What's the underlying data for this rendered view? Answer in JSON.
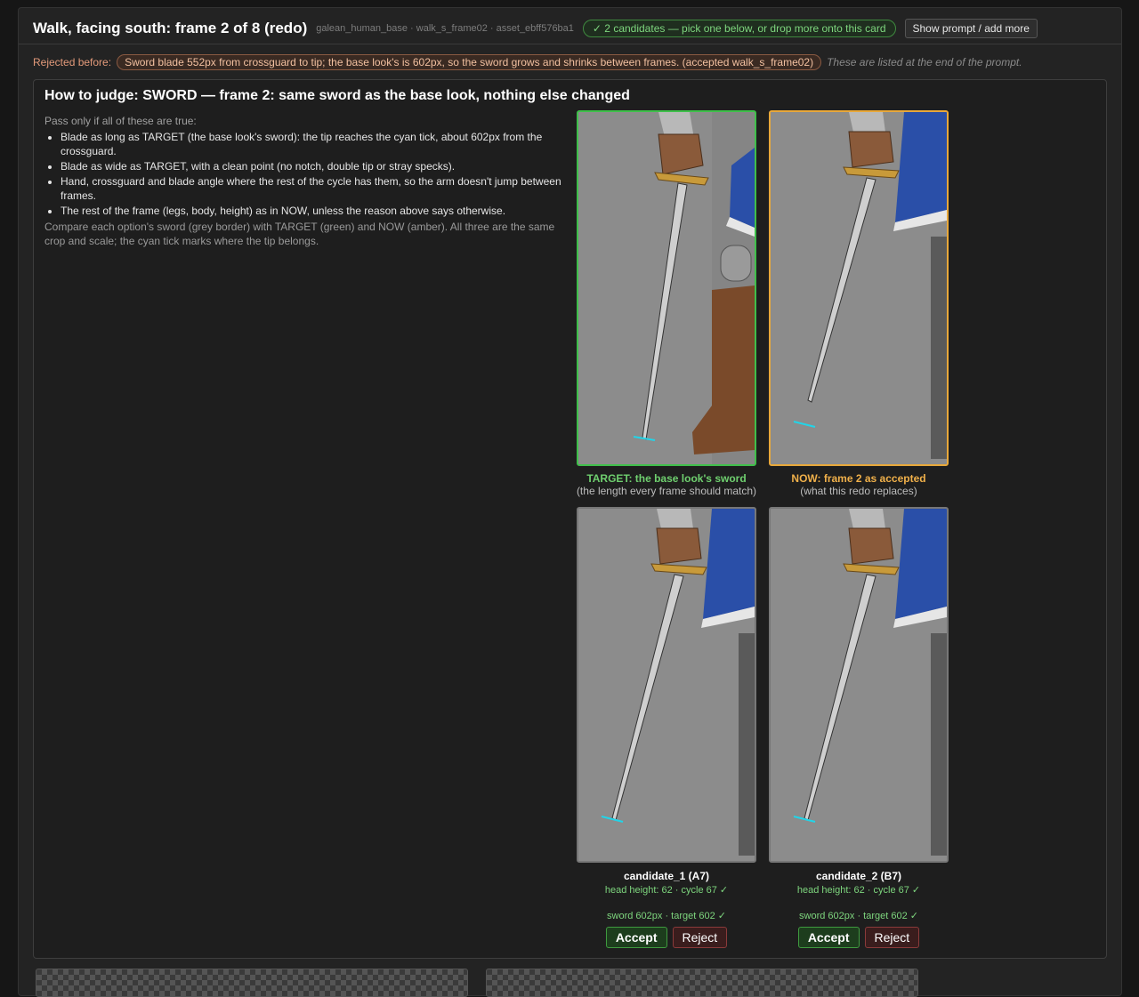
{
  "header": {
    "title": "Walk, facing south: frame 2 of 8 (redo)",
    "meta": "galean_human_base · walk_s_frame02 · asset_ebff576ba1",
    "candidates_pill": "✓ 2 candidates — pick one below, or drop more onto this card",
    "prompt_button": "Show prompt / add more"
  },
  "rejected": {
    "label": "Rejected before:",
    "reason": "Sword blade 552px from crossguard to tip; the base look's is 602px, so the sword grows and shrinks between frames. (accepted walk_s_frame02)",
    "note": "These are listed at the end of the prompt."
  },
  "judge": {
    "title": "How to judge: SWORD — frame 2: same sword as the base look, nothing else changed",
    "intro": "Pass only if all of these are true:",
    "criteria": [
      "Blade as long as TARGET (the base look's sword): the tip reaches the cyan tick, about 602px from the crossguard.",
      "Blade as wide as TARGET, with a clean point (no notch, double tip or stray specks).",
      "Hand, crossguard and blade angle where the rest of the cycle has them, so the arm doesn't jump between frames.",
      "The rest of the frame (legs, body, height) as in NOW, unless the reason above says otherwise."
    ],
    "outro": "Compare each option's sword (grey border) with TARGET (green) and NOW (amber). All three are the same crop and scale; the cyan tick marks where the tip belongs."
  },
  "reference": {
    "target_caption": "TARGET: the base look's sword",
    "target_sub": "(the length every frame should match)",
    "now_caption": "NOW: frame 2 as accepted",
    "now_sub": "(what this redo replaces)"
  },
  "candidates": [
    {
      "name": "candidate_1 (A7)",
      "stats": "head height: 62 · cycle 67 ✓",
      "sword": "sword 602px · target 602 ✓",
      "accept": "Accept",
      "reject": "Reject"
    },
    {
      "name": "candidate_2 (B7)",
      "stats": "head height: 62 · cycle 67 ✓",
      "sword": "sword 602px · target 602 ✓",
      "accept": "Accept",
      "reject": "Reject"
    }
  ],
  "colors": {
    "target_border": "#3fbf4a",
    "now_border": "#e8a83a",
    "tick": "#22d4e8",
    "tunic_blue": "#2a4fa8"
  },
  "icons": [
    "sword-illustration",
    "cyan-tick-marker",
    "check-icon"
  ]
}
